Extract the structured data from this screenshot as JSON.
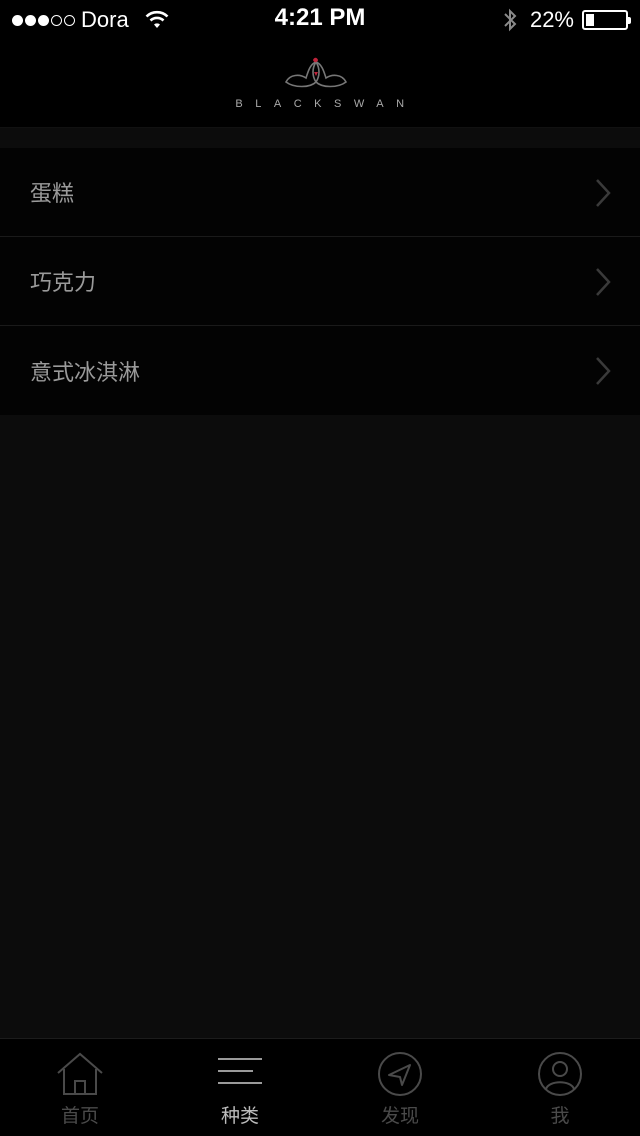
{
  "status_bar": {
    "carrier": "Dora",
    "time": "4:21 PM",
    "battery_percent_text": "22%",
    "battery_level": 0.22,
    "signal_bars_filled": 3,
    "signal_bars_total": 5
  },
  "header": {
    "logo_text": "BLACKSWAN"
  },
  "categories": [
    {
      "label": "蛋糕"
    },
    {
      "label": "巧克力"
    },
    {
      "label": "意式冰淇淋"
    }
  ],
  "tabbar": {
    "tabs": [
      {
        "label": "首页",
        "icon": "home-icon",
        "active": false
      },
      {
        "label": "种类",
        "icon": "menu-lines-icon",
        "active": true
      },
      {
        "label": "发现",
        "icon": "compass-navigation-icon",
        "active": false
      },
      {
        "label": "我",
        "icon": "user-profile-icon",
        "active": false
      }
    ]
  },
  "colors": {
    "background": "#0c0c0c",
    "list_background": "#030303",
    "list_text": "#9a9a9a",
    "tab_active": "#bdbdbd",
    "tab_inactive": "#4a4a4a",
    "logo_accent": "#c0233a"
  }
}
